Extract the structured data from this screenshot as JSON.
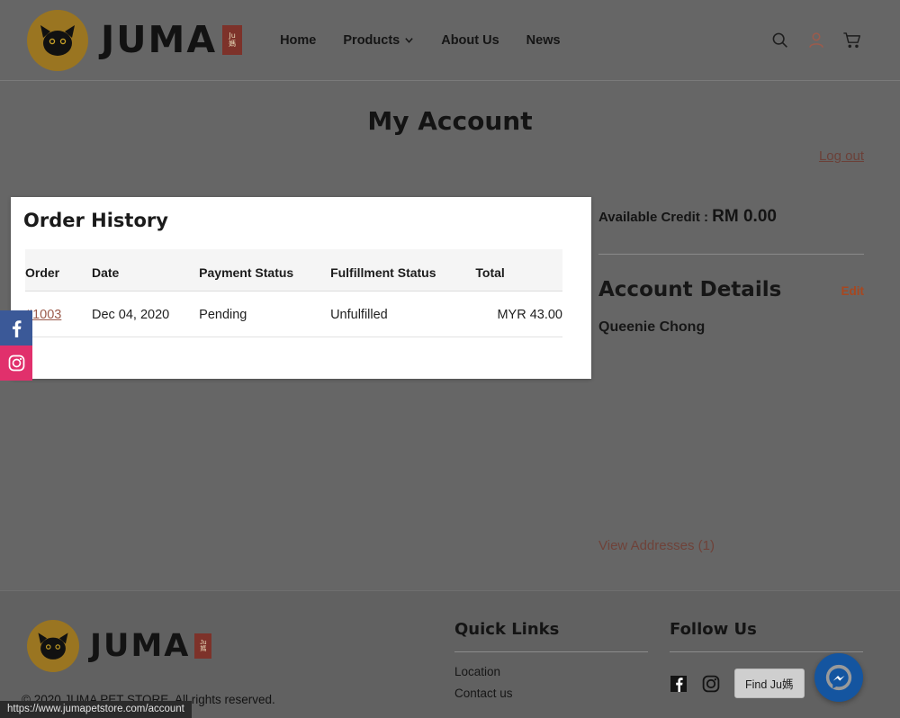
{
  "browser": {
    "status_url": "https://www.jumapetstore.com/account"
  },
  "header": {
    "logo_name": "juma-cat-logo",
    "wordmark": "JUMA",
    "seal_top": "Ju",
    "seal_bottom": "媽",
    "nav": [
      {
        "label": "Home",
        "name": "nav-home",
        "has_chevron": false
      },
      {
        "label": "Products",
        "name": "nav-products",
        "has_chevron": true
      },
      {
        "label": "About Us",
        "name": "nav-about-us",
        "has_chevron": false
      },
      {
        "label": "News",
        "name": "nav-news",
        "has_chevron": false
      }
    ],
    "icons": [
      {
        "name": "search-icon",
        "color": "#1d1d1d"
      },
      {
        "name": "account-icon",
        "color": "#9b5b4c"
      },
      {
        "name": "cart-icon",
        "color": "#1d1d1d"
      }
    ]
  },
  "page": {
    "title": "My Account",
    "logout_label": "Log out"
  },
  "order_history": {
    "title": "Order History",
    "columns": [
      "Order",
      "Date",
      "Payment Status",
      "Fulfillment Status",
      "Total"
    ],
    "rows": [
      {
        "order": "#1003",
        "date": "Dec 04, 2020",
        "payment_status": "Pending",
        "fulfillment_status": "Unfulfilled",
        "total": "MYR 43.00"
      }
    ]
  },
  "account": {
    "credit_label": "Available Credit :",
    "credit_amount": "RM 0.00",
    "details_title": "Account Details",
    "edit_label": "Edit",
    "customer_name": "Queenie Chong",
    "view_addresses_label": "View Addresses (1)"
  },
  "social_rail": [
    {
      "name": "rail-facebook",
      "color": "#3b5998"
    },
    {
      "name": "rail-instagram",
      "color": "#e1306c"
    }
  ],
  "footer": {
    "wordmark": "JUMA",
    "seal_top": "Ju",
    "seal_bottom": "媽",
    "copyright": "© 2020 JUMA PET STORE. All rights reserved.",
    "quick_links": {
      "title": "Quick Links",
      "items": [
        "Location",
        "Contact us"
      ]
    },
    "follow": {
      "title": "Follow Us",
      "find_button_label": "Find Ju媽",
      "icons": [
        "facebook-icon",
        "instagram-icon"
      ]
    },
    "messenger_name": "messenger-button"
  },
  "colors": {
    "accent_link": "#9b5b4c",
    "accent_edit": "#a8471f",
    "logo_gold": "#9a7521",
    "seal_red": "#7d322a",
    "facebook": "#3b5998",
    "instagram": "#e1306c",
    "messenger": "#1455a0"
  }
}
